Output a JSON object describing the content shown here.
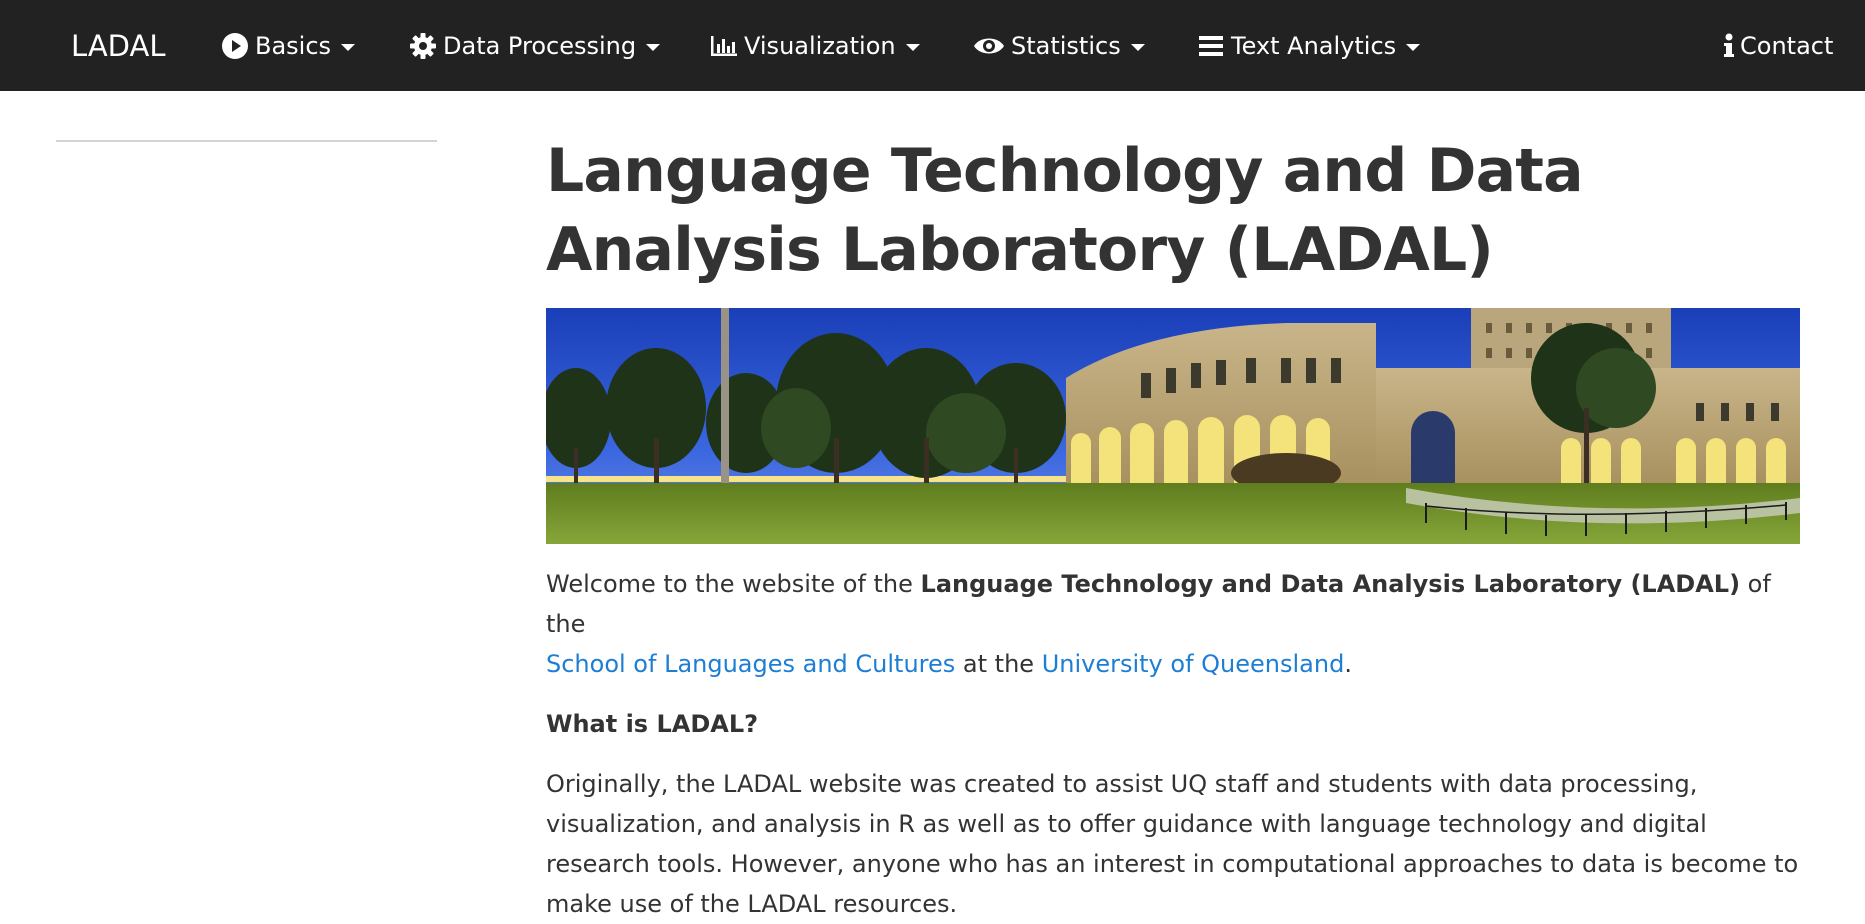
{
  "navbar": {
    "brand": "LADAL",
    "items": [
      {
        "label": "Basics",
        "icon": "play-circle-icon"
      },
      {
        "label": "Data Processing",
        "icon": "gear-icon"
      },
      {
        "label": "Visualization",
        "icon": "bar-chart-icon"
      },
      {
        "label": "Statistics",
        "icon": "eye-icon"
      },
      {
        "label": "Text Analytics",
        "icon": "bars-icon"
      }
    ],
    "contact": {
      "label": "Contact",
      "icon": "info-icon"
    }
  },
  "main": {
    "title": "Language Technology and Data Analysis Laboratory (LADAL)",
    "banner_image": "campus-panorama",
    "intro": {
      "before": "Welcome to the website of the ",
      "bold": "Language Technology and Data Analysis Laboratory (LADAL)",
      "after_bold": " of the",
      "link1": "School of Languages and Cultures",
      "between": " at the ",
      "link2": "University of Queensland",
      "end": "."
    },
    "subheading": "What is LADAL?",
    "paragraph": "Originally, the LADAL website was created to assist UQ staff and students with data processing, visualization, and analysis in R as well as to offer guidance with language technology and digital research tools. However, anyone who has an interest in computational approaches to data is become to make use of the LADAL resources."
  },
  "colors": {
    "navbar_bg": "#222222",
    "link": "#1d7ed4",
    "text": "#333333"
  }
}
